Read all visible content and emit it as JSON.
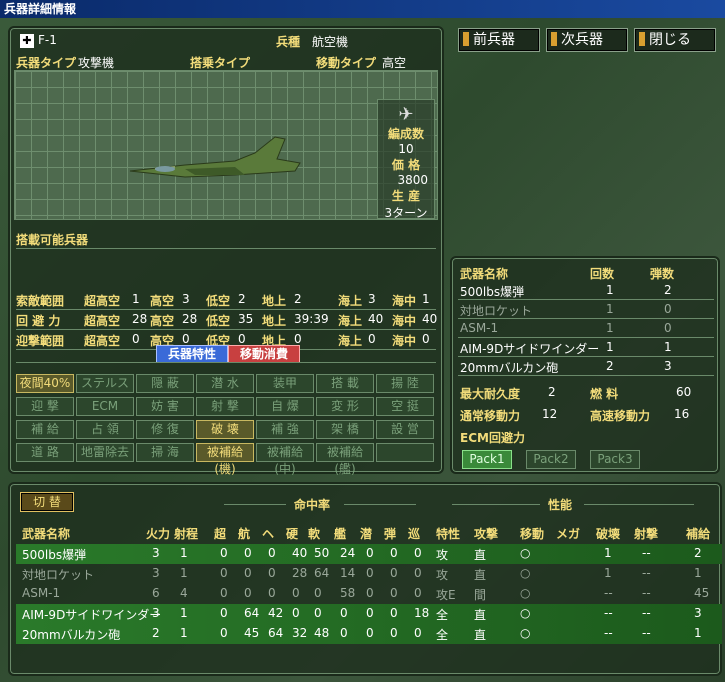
{
  "window": {
    "title": "兵器詳細情報"
  },
  "nav": {
    "prev": "前兵器",
    "next": "次兵器",
    "close": "閉じる"
  },
  "unit": {
    "name": "F-1",
    "kind_label": "兵種",
    "kind": "航空機",
    "type_label": "兵器タイプ",
    "type": "攻撃機",
    "carry_label": "搭乗タイプ",
    "carry": "",
    "move_label": "移動タイプ",
    "move": "高空"
  },
  "stats": {
    "squad_label": "編成数",
    "squad": "10",
    "price_label": "価 格",
    "price": "3800",
    "prod_label": "生 産",
    "prod": "3ターン"
  },
  "equip_label": "搭載可能兵器",
  "ranges": [
    {
      "label": "索敵範囲",
      "cells": [
        "超高空",
        "1",
        "高空",
        "3",
        "低空",
        "2",
        "地上",
        "2",
        "海上",
        "3",
        "海中",
        "1"
      ]
    },
    {
      "label": "回 避 力",
      "cells": [
        "超高空",
        "28",
        "高空",
        "28",
        "低空",
        "35",
        "地上",
        "39:39",
        "海上",
        "40",
        "海中",
        "40"
      ]
    },
    {
      "label": "迎撃範囲",
      "cells": [
        "超高空",
        "0",
        "高空",
        "0",
        "低空",
        "0",
        "地上",
        "0",
        "海上",
        "0",
        "海中",
        "0"
      ]
    }
  ],
  "tabs": {
    "traits": "兵器特性",
    "move_cost": "移動消費"
  },
  "traits": [
    [
      "夜間40%",
      "ステルス",
      "隠 蔽",
      "潜 水",
      "装甲",
      "搭 載",
      "揚 陸"
    ],
    [
      "迎 撃",
      "ECM",
      "妨 害",
      "射 撃",
      "自 爆",
      "変 形",
      "空 挺"
    ],
    [
      "補 給",
      "占 領",
      "修 復",
      "破 壊",
      "補 強",
      "架 橋",
      "設 営"
    ],
    [
      "道 路",
      "地雷除去",
      "掃 海",
      "被補給(機)",
      "被補給(中)",
      "被補給(艦)",
      ""
    ]
  ],
  "traits_on": [
    [
      1,
      0,
      0,
      0,
      0,
      0,
      0
    ],
    [
      0,
      0,
      0,
      0,
      0,
      0,
      0
    ],
    [
      0,
      0,
      0,
      1,
      0,
      0,
      0
    ],
    [
      0,
      0,
      0,
      1,
      0,
      0,
      0
    ]
  ],
  "weapons_panel": {
    "h_name": "武器名称",
    "h_count": "回数",
    "h_ammo": "弾数",
    "rows": [
      [
        "500lbs爆弾",
        "1",
        "2"
      ],
      [
        "対地ロケット",
        "1",
        "0"
      ],
      [
        "ASM-1",
        "1",
        "0"
      ],
      [
        "AIM-9Dサイドワインダー",
        "1",
        "1"
      ],
      [
        "20mmバルカン砲",
        "2",
        "3"
      ]
    ],
    "durability_label": "最大耐久度",
    "durability": "2",
    "fuel_label": "燃 料",
    "fuel": "60",
    "move_label": "通常移動力",
    "move": "12",
    "fast_label": "高速移動力",
    "fast": "16",
    "ecm_label": "ECM回避力",
    "packs": [
      "Pack1",
      "Pack2",
      "Pack3"
    ]
  },
  "bottom": {
    "switch": "切 替",
    "hit_label": "命中率",
    "perf_label": "性能",
    "headers": [
      "武器名称",
      "火力",
      "射程",
      "超",
      "航",
      "ヘ",
      "硬",
      "軟",
      "艦",
      "潜",
      "弾",
      "巡",
      "特性",
      "攻撃",
      "移動",
      "メガ",
      "破壊",
      "射撃",
      "補給"
    ],
    "rows": [
      [
        "500lbs爆弾",
        "3",
        "1",
        "0",
        "0",
        "0",
        "40",
        "50",
        "24",
        "0",
        "0",
        "0",
        "攻",
        "直",
        "○",
        "",
        "1",
        "--",
        "2"
      ],
      [
        "対地ロケット",
        "3",
        "1",
        "0",
        "0",
        "0",
        "28",
        "64",
        "14",
        "0",
        "0",
        "0",
        "攻",
        "直",
        "○",
        "",
        "1",
        "--",
        "1"
      ],
      [
        "ASM-1",
        "6",
        "4",
        "0",
        "0",
        "0",
        "0",
        "0",
        "58",
        "0",
        "0",
        "0",
        "攻E",
        "間",
        "○",
        "",
        "--",
        "--",
        "45"
      ],
      [
        "AIM-9Dサイドワインダー",
        "3",
        "1",
        "0",
        "64",
        "42",
        "0",
        "0",
        "0",
        "0",
        "0",
        "18",
        "全",
        "直",
        "○",
        "",
        "--",
        "--",
        "3"
      ],
      [
        "20mmバルカン砲",
        "2",
        "1",
        "0",
        "45",
        "64",
        "32",
        "48",
        "0",
        "0",
        "0",
        "0",
        "全",
        "直",
        "○",
        "",
        "--",
        "--",
        "1"
      ]
    ]
  }
}
